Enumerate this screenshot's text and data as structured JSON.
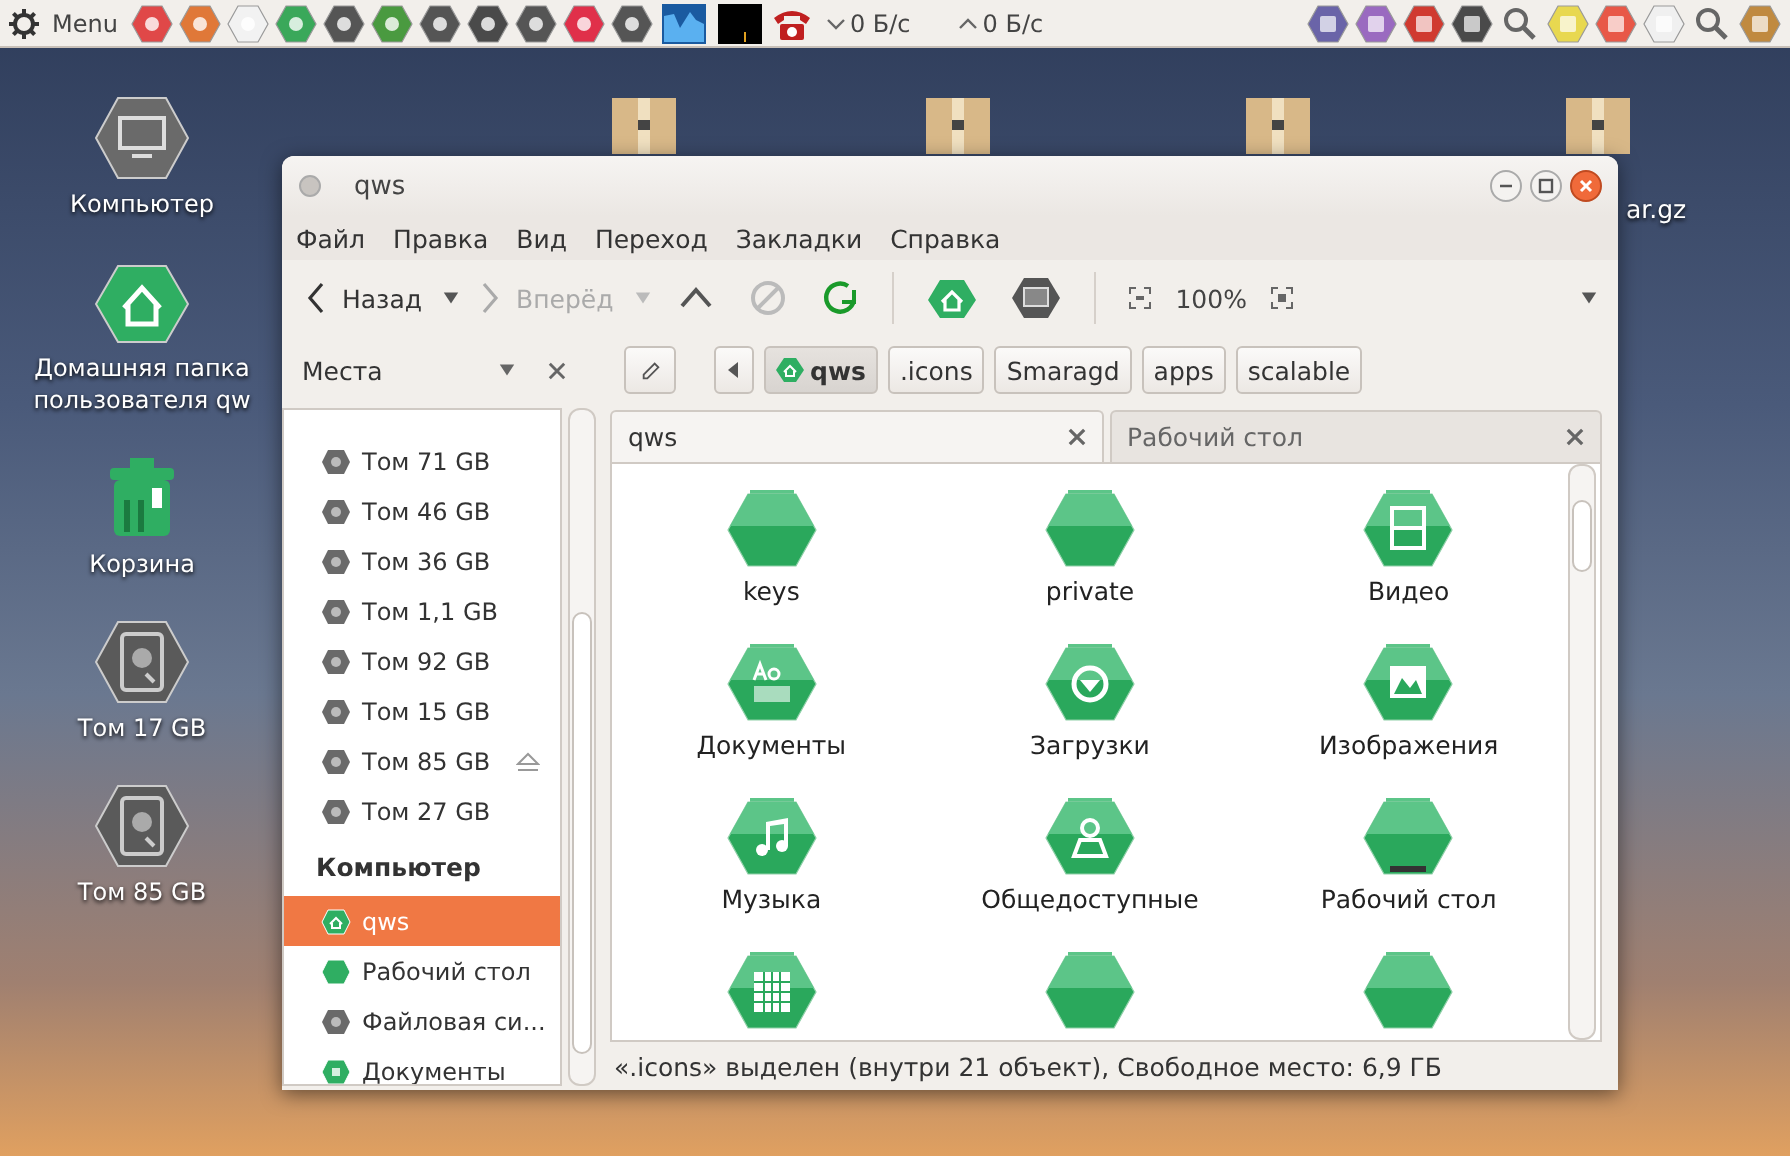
{
  "panel": {
    "menu_label": "Menu",
    "net_down": "0 Б/с",
    "net_up": "0 Б/с"
  },
  "desktop": {
    "icons": [
      {
        "label": "Компьютер",
        "kind": "computer"
      },
      {
        "label": "Домашняя папка пользователя qw",
        "kind": "home"
      },
      {
        "label": "Корзина",
        "kind": "trash"
      },
      {
        "label": "Том 17 GB",
        "kind": "drive"
      },
      {
        "label": "Том 85 GB",
        "kind": "drive"
      }
    ],
    "archive_label": "ar.gz"
  },
  "window": {
    "title": "qws",
    "menu": [
      "Файл",
      "Правка",
      "Вид",
      "Переход",
      "Закладки",
      "Справка"
    ],
    "toolbar": {
      "back": {
        "label": "Назад",
        "disabled": false
      },
      "forward": {
        "label": "Вперёд",
        "disabled": true
      },
      "zoom": "100%"
    },
    "places_label": "Места",
    "path": [
      {
        "label": "qws",
        "selected": true
      },
      {
        "label": ".icons",
        "selected": false
      },
      {
        "label": "Smaragd",
        "selected": false
      },
      {
        "label": "apps",
        "selected": false
      },
      {
        "label": "scalable",
        "selected": false
      }
    ],
    "sidebar": [
      {
        "label": "Том 71 GB",
        "kind": "drive",
        "selected": false,
        "ejectable": false
      },
      {
        "label": "Том 46 GB",
        "kind": "drive",
        "selected": false,
        "ejectable": false
      },
      {
        "label": "Том 36 GB",
        "kind": "drive",
        "selected": false,
        "ejectable": false
      },
      {
        "label": "Том 1,1 GB",
        "kind": "drive",
        "selected": false,
        "ejectable": false
      },
      {
        "label": "Том 92 GB",
        "kind": "drive",
        "selected": false,
        "ejectable": false
      },
      {
        "label": "Том 15 GB",
        "kind": "drive",
        "selected": false,
        "ejectable": false
      },
      {
        "label": "Том 85 GB",
        "kind": "drive",
        "selected": false,
        "ejectable": true
      },
      {
        "label": "Том 27 GB",
        "kind": "drive",
        "selected": false,
        "ejectable": false
      },
      {
        "label": "Компьютер",
        "kind": "heading"
      },
      {
        "label": "qws",
        "kind": "home",
        "selected": true,
        "ejectable": false
      },
      {
        "label": "Рабочий стол",
        "kind": "desktop",
        "selected": false,
        "ejectable": false
      },
      {
        "label": "Файловая си...",
        "kind": "drive",
        "selected": false,
        "ejectable": false
      },
      {
        "label": "Документы",
        "kind": "documents",
        "selected": false,
        "ejectable": false
      }
    ],
    "tabs": [
      {
        "label": "qws",
        "selected": true
      },
      {
        "label": "Рабочий стол",
        "selected": false
      }
    ],
    "files": [
      {
        "name": "keys",
        "kind": "folder"
      },
      {
        "name": "private",
        "kind": "folder"
      },
      {
        "name": "Видео",
        "kind": "video"
      },
      {
        "name": "Документы",
        "kind": "documents"
      },
      {
        "name": "Загрузки",
        "kind": "downloads"
      },
      {
        "name": "Изображения",
        "kind": "pictures"
      },
      {
        "name": "Музыка",
        "kind": "music"
      },
      {
        "name": "Общедоступные",
        "kind": "public"
      },
      {
        "name": "Рабочий стол",
        "kind": "desktop"
      },
      {
        "kind": "grid"
      },
      {
        "kind": "folder"
      },
      {
        "kind": "folder"
      }
    ],
    "status": "«.icons» выделен (внутри 21 объект), Свободное место: 6,9 ГБ"
  }
}
